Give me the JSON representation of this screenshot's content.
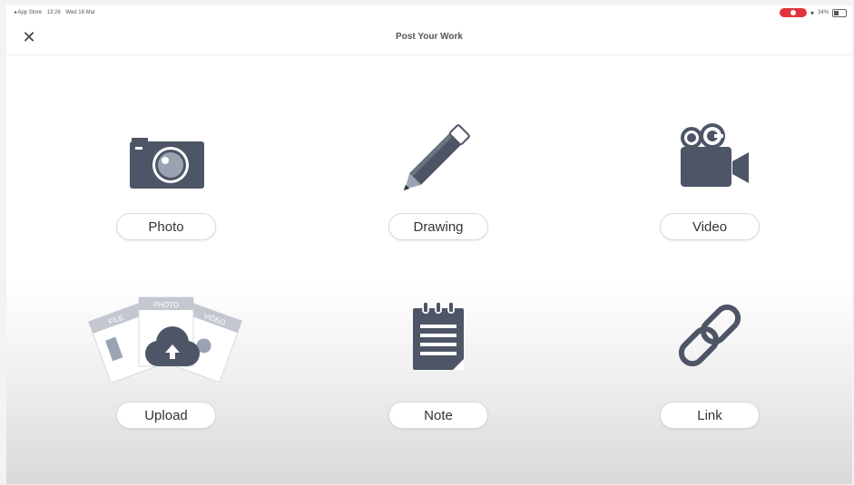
{
  "status_bar": {
    "left_items": [
      "◂ App Store",
      "13:26",
      "Wed 18 Mar"
    ],
    "battery": "34%"
  },
  "nav": {
    "title": "Post Your Work",
    "close_icon": "close-icon"
  },
  "options": [
    {
      "label": "Photo",
      "icon": "camera-icon"
    },
    {
      "label": "Drawing",
      "icon": "pencil-icon"
    },
    {
      "label": "Video",
      "icon": "video-camera-icon"
    },
    {
      "label": "Upload",
      "icon": "cloud-upload-icon",
      "card_labels": [
        "FILE",
        "PHOTO",
        "VIDEO"
      ]
    },
    {
      "label": "Note",
      "icon": "notepad-icon"
    },
    {
      "label": "Link",
      "icon": "link-icon"
    }
  ],
  "colors": {
    "icon": "#4d5566",
    "recording": "#e0343c"
  }
}
